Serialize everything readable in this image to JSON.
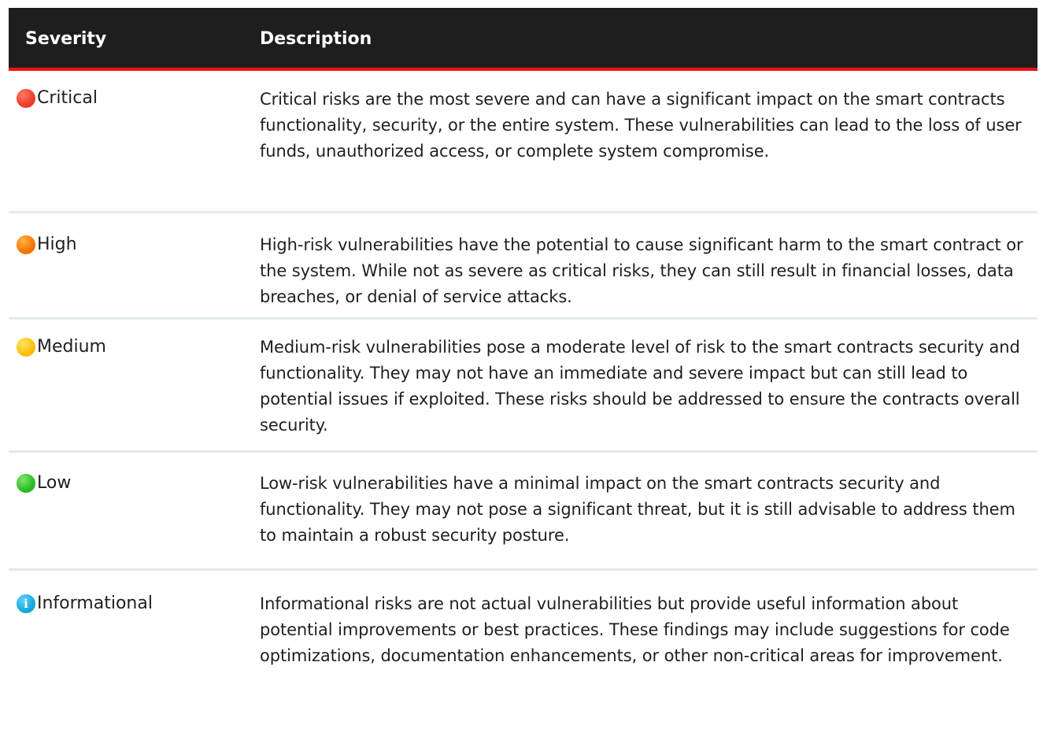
{
  "table": {
    "headers": {
      "severity": "Severity",
      "description": "Description"
    },
    "rows": [
      {
        "severity": "Critical",
        "icon": "red-circle-icon",
        "color": "#f0412f",
        "description": "Critical risks are the most severe and can have a significant impact on the smart contracts functionality, security, or the entire system. These vulnerabilities can lead to the loss of user funds, unauthorized access, or complete system compromise."
      },
      {
        "severity": "High",
        "icon": "orange-circle-icon",
        "color": "#f77a06",
        "description": "High-risk vulnerabilities have the potential to cause significant harm to the smart contract or the system. While not as severe as critical risks, they can still result in financial losses, data breaches, or denial of service attacks."
      },
      {
        "severity": "Medium",
        "icon": "yellow-circle-icon",
        "color": "#fcc30a",
        "description": "Medium-risk vulnerabilities pose a moderate level of risk to the smart contracts security and functionality. They may not have an immediate and severe impact but can still lead to potential issues if exploited. These risks should be addressed to ensure the contracts overall security."
      },
      {
        "severity": "Low",
        "icon": "green-circle-icon",
        "color": "#2fc02a",
        "description": "Low-risk vulnerabilities have a minimal impact on the smart contracts security and functionality. They may not pose a significant threat, but it is still advisable to address them to maintain a robust security posture."
      },
      {
        "severity": "Informational",
        "icon": "info-icon",
        "icon_glyph": "i",
        "color": "#1aaee0",
        "description": "Informational risks are not actual vulnerabilities but provide useful information about potential improvements or best practices. These findings may include suggestions for code optimizations, documentation enhancements, or other non-critical areas for improvement."
      }
    ]
  }
}
